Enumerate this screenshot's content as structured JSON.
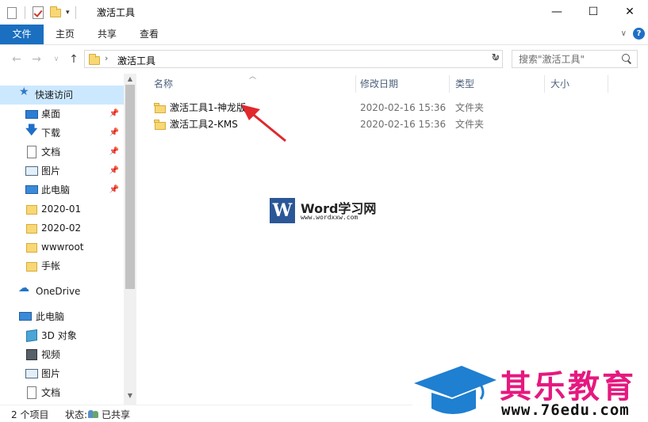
{
  "window": {
    "title": "激活工具",
    "minimize": "—",
    "maximize": "☐",
    "close": "✕"
  },
  "ribbon": {
    "tabs": [
      {
        "label": "文件"
      },
      {
        "label": "主页"
      },
      {
        "label": "共享"
      },
      {
        "label": "查看"
      }
    ],
    "help": "?",
    "collapse": "∨"
  },
  "nav": {
    "back": "←",
    "forward": "→",
    "recent": "∨",
    "up": "↑",
    "path_sep": "›",
    "path": "激活工具",
    "address_dropdown": "∨",
    "refresh": "↻",
    "search_placeholder": "搜索\"激活工具\""
  },
  "sidebar": {
    "quick_access": "快速访问",
    "pinned": [
      {
        "label": "桌面",
        "icon": "desktop-icon"
      },
      {
        "label": "下载",
        "icon": "download-icon"
      },
      {
        "label": "文档",
        "icon": "documents-icon"
      },
      {
        "label": "图片",
        "icon": "pictures-icon"
      },
      {
        "label": "此电脑",
        "icon": "computer-icon"
      }
    ],
    "recent": [
      {
        "label": "2020-01"
      },
      {
        "label": "2020-02"
      },
      {
        "label": "wwwroot"
      },
      {
        "label": "手帐"
      }
    ],
    "onedrive": "OneDrive",
    "this_pc": "此电脑",
    "pc_items": [
      {
        "label": "3D 对象",
        "icon": "3d-objects-icon"
      },
      {
        "label": "视频",
        "icon": "videos-icon"
      },
      {
        "label": "图片",
        "icon": "pictures-icon"
      },
      {
        "label": "文档",
        "icon": "documents-icon"
      }
    ]
  },
  "columns": {
    "name": "名称",
    "date": "修改日期",
    "type": "类型",
    "size": "大小"
  },
  "files": [
    {
      "name": "激活工具1-神龙版",
      "date": "2020-02-16 15:36",
      "type": "文件夹"
    },
    {
      "name": "激活工具2-KMS",
      "date": "2020-02-16 15:36",
      "type": "文件夹"
    }
  ],
  "status": {
    "count": "2 个项目",
    "state_label": "状态:",
    "state_value": "已共享"
  },
  "watermarks": {
    "word_logo": "W",
    "word_title": "Word学习网",
    "word_url": "www.wordxxw.com",
    "site_title": "其乐教育",
    "site_url": "www.76edu.com"
  },
  "colors": {
    "accent": "#1a6fc1",
    "selection": "#cce8ff",
    "folder": "#f8d775",
    "arrow": "#e0282d",
    "site_title": "#e5197f"
  }
}
